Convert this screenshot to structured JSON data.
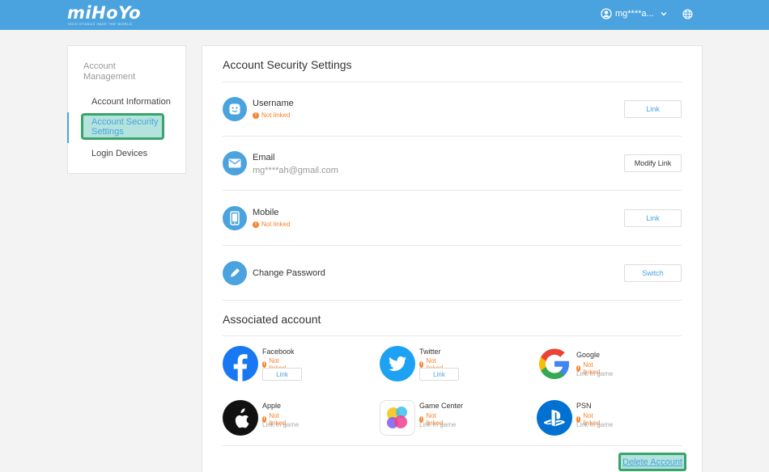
{
  "header": {
    "logo": "miHoYo",
    "logo_tagline": "TECH OTAKUS SAVE THE WORLD",
    "username": "mg****a..."
  },
  "sidebar": {
    "heading": "Account Management",
    "items": [
      {
        "label": "Account Information"
      },
      {
        "label": "Account Security Settings"
      },
      {
        "label": "Login Devices"
      }
    ]
  },
  "security": {
    "title": "Account Security Settings",
    "rows": [
      {
        "label": "Username",
        "status": "Not linked",
        "button": "Link"
      },
      {
        "label": "Email",
        "value": "mg****ah@gmail.com",
        "button": "Modify Link"
      },
      {
        "label": "Mobile",
        "status": "Not linked",
        "button": "Link"
      },
      {
        "label": "Change Password",
        "button": "Switch"
      }
    ]
  },
  "associated": {
    "title": "Associated account",
    "services": [
      {
        "name": "Facebook",
        "status": "Not linked",
        "button": "Link"
      },
      {
        "name": "Twitter",
        "status": "Not linked",
        "button": "Link"
      },
      {
        "name": "Google",
        "status": "Not linked",
        "hint": "Link in game"
      },
      {
        "name": "Apple",
        "status": "Not linked",
        "hint": "Link in game"
      },
      {
        "name": "Game Center",
        "status": "Not linked",
        "hint": "Link in game"
      },
      {
        "name": "PSN",
        "status": "Not linked",
        "hint": "Link in game"
      }
    ]
  },
  "footer": {
    "delete_label": "Delete Account"
  },
  "colors": {
    "accent": "#4aa3df",
    "warning": "#f5842e",
    "highlight_border": "#3aa36a",
    "highlight_fill": "#b2e3dc",
    "facebook": "#1877f2",
    "twitter": "#1da1f2",
    "psn": "#0070d1"
  },
  "icons": [
    "user-circle-icon",
    "chevron-down-icon",
    "globe-icon",
    "smile-icon",
    "envelope-icon",
    "phone-icon",
    "pencil-icon",
    "facebook-icon",
    "twitter-icon",
    "google-icon",
    "apple-icon",
    "game-center-icon",
    "psn-icon",
    "warning-icon"
  ]
}
